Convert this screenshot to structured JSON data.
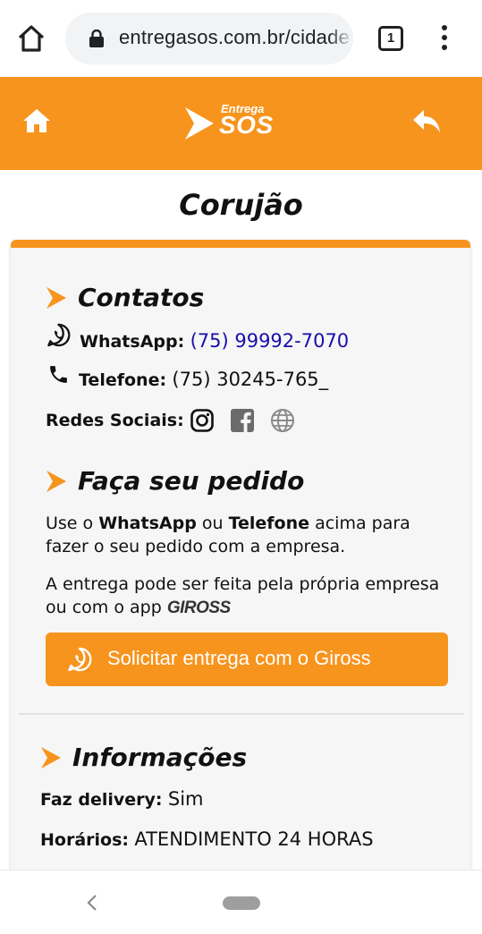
{
  "browser": {
    "url": "entregasos.com.br/cidade",
    "tab_count": "1"
  },
  "header": {
    "logo_small": "Entrega",
    "logo_big": "SOS"
  },
  "page": {
    "title": "Corujão"
  },
  "contatos": {
    "heading": "Contatos",
    "whatsapp_label": "WhatsApp:",
    "whatsapp_value": "(75) 99992-7070",
    "telefone_label": "Telefone:",
    "telefone_value": "(75) 30245-765_",
    "redes_label": "Redes Sociais:"
  },
  "pedido": {
    "heading": "Faça seu pedido",
    "p1_a": "Use o ",
    "p1_b": "WhatsApp",
    "p1_c": " ou ",
    "p1_d": "Telefone",
    "p1_e": " acima para fazer o seu pedido com a empresa.",
    "p2": "A entrega pode ser feita pela própria empresa ou com o app",
    "gross_logo": "GIROSS",
    "cta_label": "Solicitar entrega com o Giross"
  },
  "informacoes": {
    "heading": "Informações",
    "delivery_label": "Faz delivery:",
    "delivery_value": "Sim",
    "horarios_label": "Horários:",
    "horarios_value": "ATENDIMENTO 24 HORAS"
  },
  "colors": {
    "brand_orange": "#f7941d",
    "link_blue": "#1a0dab"
  }
}
